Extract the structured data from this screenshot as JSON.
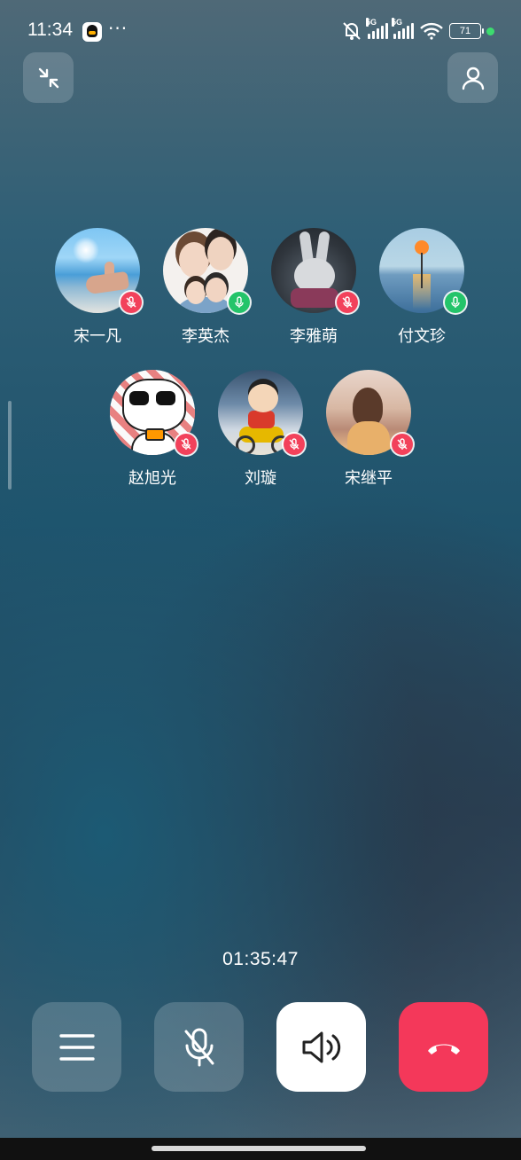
{
  "status_bar": {
    "time": "11:34",
    "overflow": "···",
    "signal1_label": "5G",
    "signal2_label": "5G",
    "battery": "71"
  },
  "participants": [
    {
      "name": "宋一凡",
      "avatar": "thumbs-up-sky",
      "mic": "muted"
    },
    {
      "name": "李英杰",
      "avatar": "cartoon-family",
      "mic": "active"
    },
    {
      "name": "李雅萌",
      "avatar": "plush-rabbit",
      "mic": "muted"
    },
    {
      "name": "付文珍",
      "avatar": "lake-sunset-tree",
      "mic": "active"
    },
    {
      "name": "赵旭光",
      "avatar": "pixel-panda",
      "mic": "muted"
    },
    {
      "name": "刘璇",
      "avatar": "crayon-boy-bike",
      "mic": "muted"
    },
    {
      "name": "宋继平",
      "avatar": "girl-at-window",
      "mic": "muted"
    }
  ],
  "call": {
    "duration": "01:35:47"
  },
  "colors": {
    "muted_badge": "#f2415b",
    "active_badge": "#24c46a",
    "hangup": "#f4385a"
  }
}
